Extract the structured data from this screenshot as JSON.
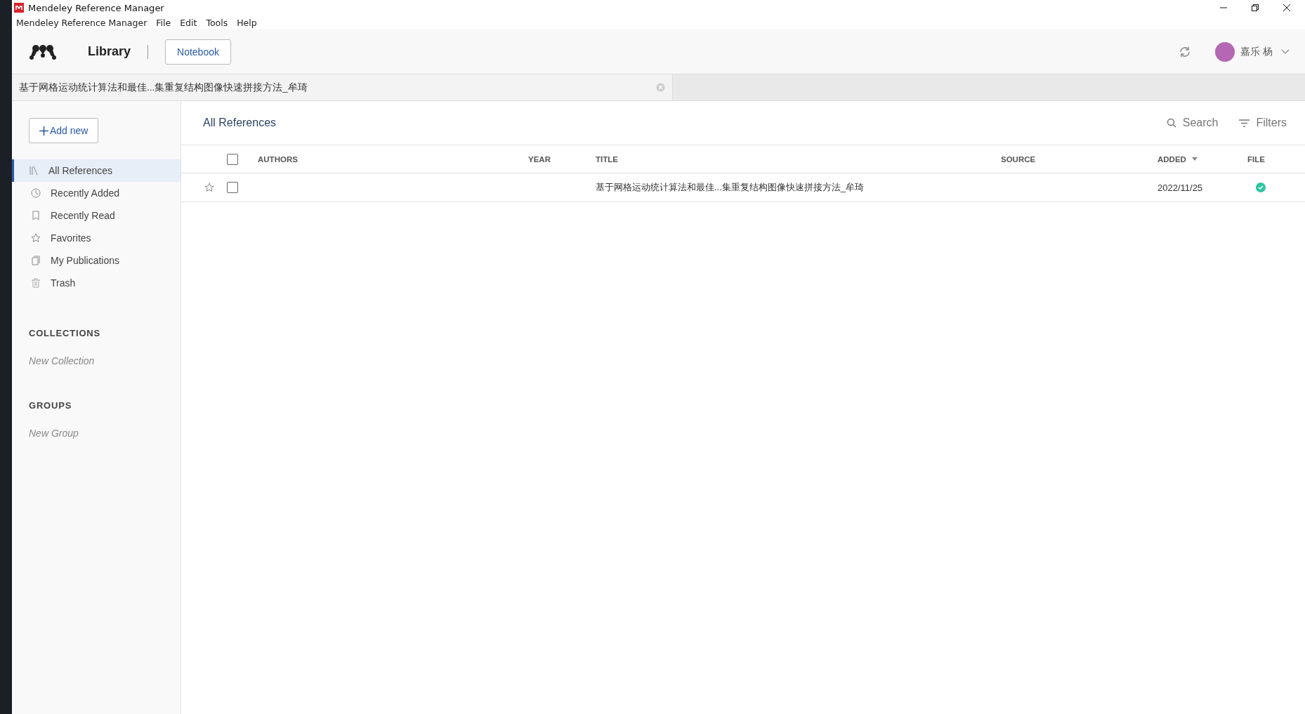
{
  "window": {
    "title": "Mendeley Reference Manager"
  },
  "menu": [
    "Mendeley Reference Manager",
    "File",
    "Edit",
    "Tools",
    "Help"
  ],
  "header": {
    "library": "Library",
    "notebook": "Notebook",
    "user": "嘉乐 杨"
  },
  "tabs": [
    {
      "label": "基于网格运动统计算法和最佳...集重复结构图像快速拼接方法_牟琦",
      "selected": true
    }
  ],
  "sidebar": {
    "add_button": "Add new",
    "items": [
      {
        "label": "All References",
        "kind": "all",
        "selected": true
      },
      {
        "label": "Recently Added",
        "kind": "clock",
        "selected": false
      },
      {
        "label": "Recently Read",
        "kind": "bookmark",
        "selected": false
      },
      {
        "label": "Favorites",
        "kind": "star",
        "selected": false
      },
      {
        "label": "My Publications",
        "kind": "publications",
        "selected": false
      },
      {
        "label": "Trash",
        "kind": "trash",
        "selected": false
      }
    ],
    "sections": [
      {
        "title": "COLLECTIONS",
        "placeholder": "New Collection"
      },
      {
        "title": "GROUPS",
        "placeholder": "New Group"
      }
    ]
  },
  "content": {
    "title": "All References",
    "search": "Search",
    "filters": "Filters"
  },
  "table": {
    "all_checked": false,
    "columns": [
      {
        "label": "AUTHORS",
        "sorted": false
      },
      {
        "label": "YEAR",
        "sorted": false
      },
      {
        "label": "TITLE",
        "sorted": false
      },
      {
        "label": "SOURCE",
        "sorted": false
      },
      {
        "label": "ADDED",
        "sorted": true
      },
      {
        "label": "FILE",
        "sorted": false
      }
    ],
    "rows": [
      {
        "favorite": false,
        "checked": false,
        "title": "基于网格运动统计算法和最佳...集重复结构图像快速拼接方法_牟琦",
        "added": "2022/11/25",
        "has_file": true
      }
    ]
  }
}
